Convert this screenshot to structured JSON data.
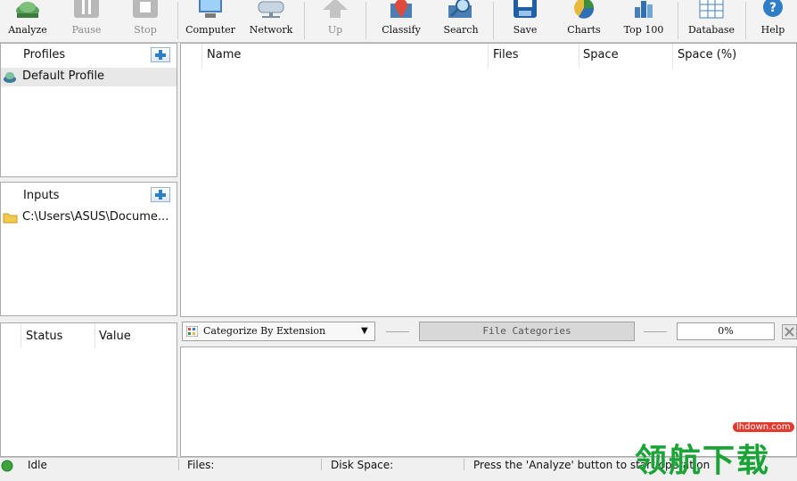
{
  "toolbar": {
    "buttons": [
      {
        "label": "Analyze",
        "icon": "analyze-icon",
        "enabled": true
      },
      {
        "label": "Pause",
        "icon": "pause-icon",
        "enabled": false
      },
      {
        "label": "Stop",
        "icon": "stop-icon",
        "enabled": false
      },
      {
        "label": "Computer",
        "icon": "computer-icon",
        "enabled": true
      },
      {
        "label": "Network",
        "icon": "network-icon",
        "enabled": true
      },
      {
        "label": "Up",
        "icon": "up-arrow-icon",
        "enabled": false
      },
      {
        "label": "Classify",
        "icon": "classify-icon",
        "enabled": true
      },
      {
        "label": "Search",
        "icon": "search-icon",
        "enabled": true
      },
      {
        "label": "Save",
        "icon": "save-icon",
        "enabled": true
      },
      {
        "label": "Charts",
        "icon": "pie-chart-icon",
        "enabled": true
      },
      {
        "label": "Top 100",
        "icon": "top-100-icon",
        "enabled": true
      },
      {
        "label": "Database",
        "icon": "database-icon",
        "enabled": true
      },
      {
        "label": "Help",
        "icon": "help-icon",
        "enabled": true
      }
    ]
  },
  "profiles": {
    "title": "Profiles",
    "items": [
      {
        "label": "Default Profile",
        "icon": "profile-icon",
        "selected": true
      }
    ]
  },
  "inputs": {
    "title": "Inputs",
    "items": [
      {
        "label": "C:\\Users\\ASUS\\Docume...",
        "icon": "folder-icon"
      }
    ]
  },
  "status_panel": {
    "columns": [
      "Status",
      "Value"
    ]
  },
  "results": {
    "columns": [
      "Name",
      "Files",
      "Space",
      "Space (%)"
    ]
  },
  "categorize": {
    "selected": "Categorize By Extension",
    "button": "File Categories",
    "progress": "0%"
  },
  "statusbar": {
    "state": "Idle",
    "files": "Files:",
    "disk_space": "Disk Space:",
    "message": "Press the 'Analyze' button to start operation"
  },
  "watermark": {
    "domain": "lhdown.com",
    "text": "领航下载"
  },
  "colors": {
    "accent_blue": "#2f6fb5",
    "panel_border": "#a9a9a9",
    "selected_row": "#e8e8e8",
    "watermark_green": "#1aa336",
    "watermark_red": "#e23b2e"
  }
}
